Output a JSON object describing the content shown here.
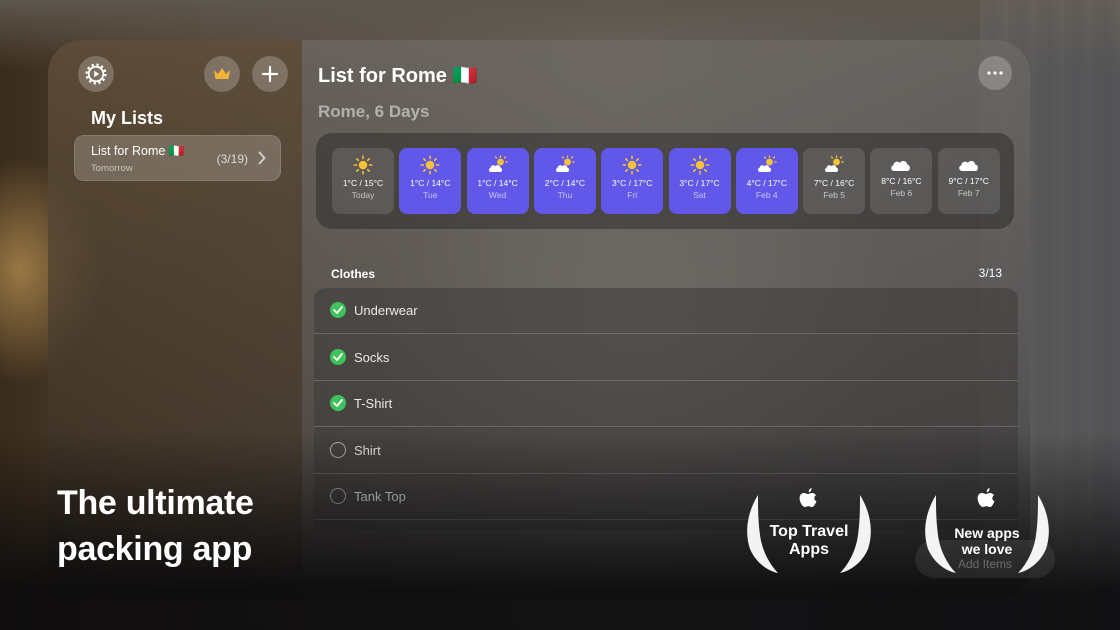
{
  "sidebar": {
    "title": "My Lists",
    "lists": [
      {
        "title": "List for Rome 🇮🇹",
        "subtitle": "Tomorrow",
        "count": "(3/19)"
      }
    ]
  },
  "main": {
    "title": "List for Rome 🇮🇹",
    "subtitle": "Rome, 6 Days",
    "forecast": [
      {
        "icon": "sun-icon",
        "temp": "1°C / 15°C",
        "label": "Today",
        "active": false
      },
      {
        "icon": "sun-icon",
        "temp": "1°C / 14°C",
        "label": "Tue",
        "active": true
      },
      {
        "icon": "partly-cloudy-icon",
        "temp": "1°C / 14°C",
        "label": "Wed",
        "active": true
      },
      {
        "icon": "partly-cloudy-icon",
        "temp": "2°C / 14°C",
        "label": "Thu",
        "active": true
      },
      {
        "icon": "sun-icon",
        "temp": "3°C / 17°C",
        "label": "Fri",
        "active": true
      },
      {
        "icon": "sun-icon",
        "temp": "3°C / 17°C",
        "label": "Sat",
        "active": true
      },
      {
        "icon": "partly-cloudy-icon",
        "temp": "4°C / 17°C",
        "label": "Feb 4",
        "active": true
      },
      {
        "icon": "partly-cloudy-icon",
        "temp": "7°C / 16°C",
        "label": "Feb 5",
        "active": false
      },
      {
        "icon": "cloud-icon",
        "temp": "8°C / 16°C",
        "label": "Feb 6",
        "active": false
      },
      {
        "icon": "cloud-icon",
        "temp": "9°C / 17°C",
        "label": "Feb 7",
        "active": false
      }
    ],
    "section": {
      "title": "Clothes",
      "count": "3/13",
      "items": [
        {
          "label": "Underwear",
          "checked": true
        },
        {
          "label": "Socks",
          "checked": true
        },
        {
          "label": "T-Shirt",
          "checked": true
        },
        {
          "label": "Shirt",
          "checked": false
        },
        {
          "label": "Tank Top",
          "checked": false
        }
      ]
    },
    "add_button": "Add Items"
  },
  "overlay": {
    "tagline_line1": "The ultimate",
    "tagline_line2": "packing app",
    "awards": [
      {
        "line1": "Top Travel",
        "line2": "Apps"
      },
      {
        "line1": "New apps",
        "line2": "we love"
      }
    ]
  },
  "colors": {
    "accent": "#6157e8",
    "check": "#3fc25c",
    "crown": "#f0b23a",
    "sun": "#f7c236"
  }
}
